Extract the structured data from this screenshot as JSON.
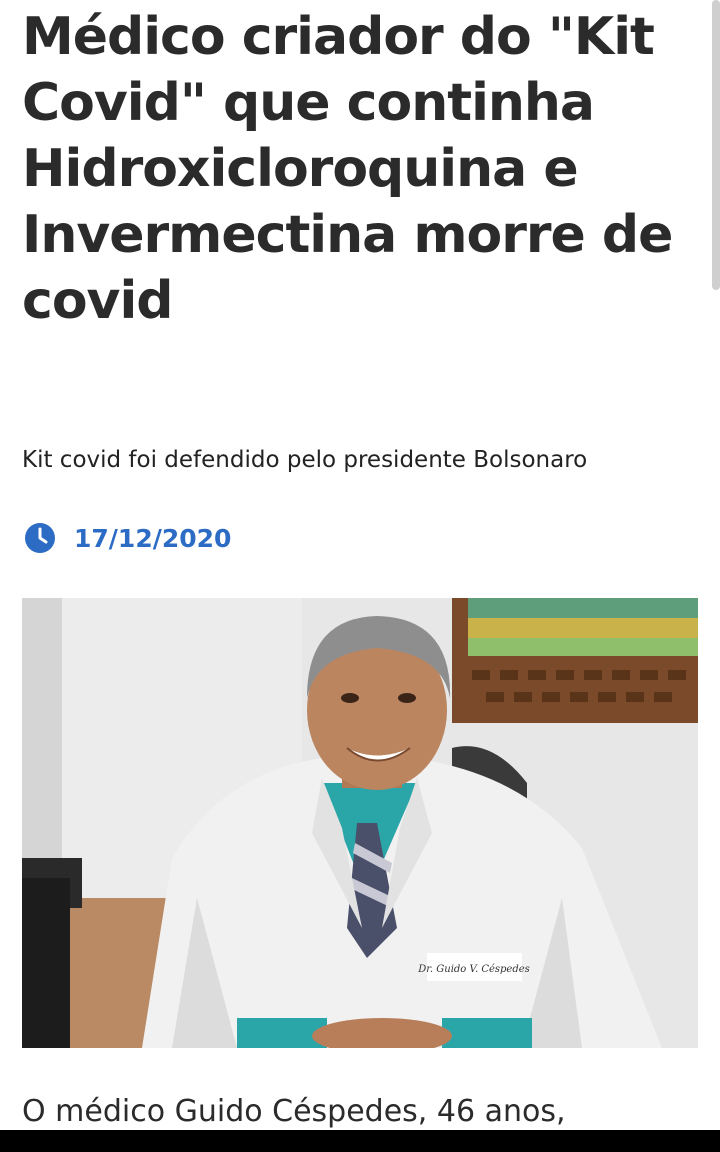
{
  "article": {
    "title": "Médico criador do \"Kit Covid\" que continha Hidroxicloroquina e Invermectina morre de covid",
    "subtitle": "Kit covid foi defendido pelo presidente Bolsonaro",
    "date": "17/12/2020",
    "date_icon": "clock-icon",
    "image": {
      "badge_text": "Dr. Guido V. Céspedes"
    },
    "body_start": "O médico Guido Céspedes, 46 anos,"
  },
  "colors": {
    "accent": "#2d6cc4",
    "title_text": "#2b2b2b",
    "background": "#ffffff"
  }
}
